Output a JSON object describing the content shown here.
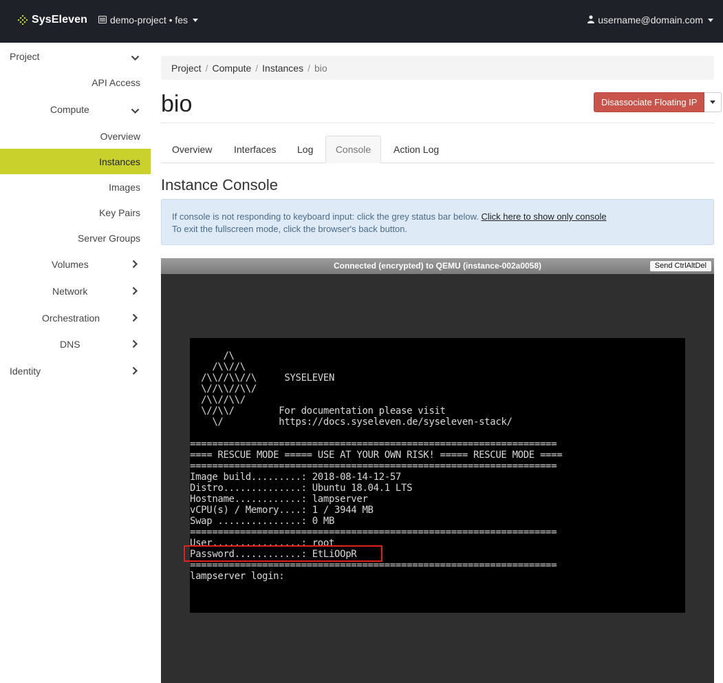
{
  "navbar": {
    "brand": "SysEleven",
    "project": "demo-project • fes",
    "user": "username@domain.com"
  },
  "sidebar": {
    "items": [
      {
        "label": "Project",
        "chevron": "down"
      },
      {
        "label": "API Access"
      },
      {
        "label": "Compute",
        "chevron": "down"
      },
      {
        "label": "Overview"
      },
      {
        "label": "Instances",
        "active": true
      },
      {
        "label": "Images"
      },
      {
        "label": "Key Pairs"
      },
      {
        "label": "Server Groups"
      },
      {
        "label": "Volumes",
        "chevron": "right"
      },
      {
        "label": "Network",
        "chevron": "right"
      },
      {
        "label": "Orchestration",
        "chevron": "right"
      },
      {
        "label": "DNS",
        "chevron": "right"
      },
      {
        "label": "Identity",
        "chevron": "right"
      }
    ]
  },
  "breadcrumb": [
    "Project",
    "Compute",
    "Instances",
    "bio"
  ],
  "page": {
    "title": "bio",
    "action_button": "Disassociate Floating IP",
    "section_title": "Instance Console"
  },
  "tabs": [
    "Overview",
    "Interfaces",
    "Log",
    "Console",
    "Action Log"
  ],
  "active_tab": "Console",
  "alert": {
    "line1": "If console is not responding to keyboard input: click the grey status bar below.",
    "link": "Click here to show only console",
    "line2": "To exit the fullscreen mode, click the browser's back button."
  },
  "console": {
    "status": "Connected (encrypted) to QEMU (instance-002a0058)",
    "send_button": "Send CtrlAltDel",
    "lines": [
      "      /\\",
      "    /\\\\//\\",
      "  /\\\\//\\\\//\\     SYSELEVEN",
      "  \\//\\\\//\\\\/",
      "  /\\\\//\\\\/",
      "  \\//\\\\/        For documentation please visit",
      "    \\/          https://docs.syseleven.de/syseleven-stack/",
      "",
      "==================================================================",
      "==== RESCUE MODE ===== USE AT YOUR OWN RISK! ===== RESCUE MODE ====",
      "==================================================================",
      "Image build.........: 2018-08-14-12-57",
      "Distro..............: Ubuntu 18.04.1 LTS",
      "Hostname............: lampserver",
      "vCPU(s) / Memory....: 1 / 3944 MB",
      "Swap ...............: 0 MB",
      "==================================================================",
      "User................: root",
      "Password............: EtLiOOpR",
      "==================================================================",
      "lampserver login:"
    ]
  },
  "colors": {
    "navbar_bg": "#1e2127",
    "sidebar_active": "#c9d12d",
    "danger": "#c9544b",
    "highlight_box": "#e0201b"
  }
}
